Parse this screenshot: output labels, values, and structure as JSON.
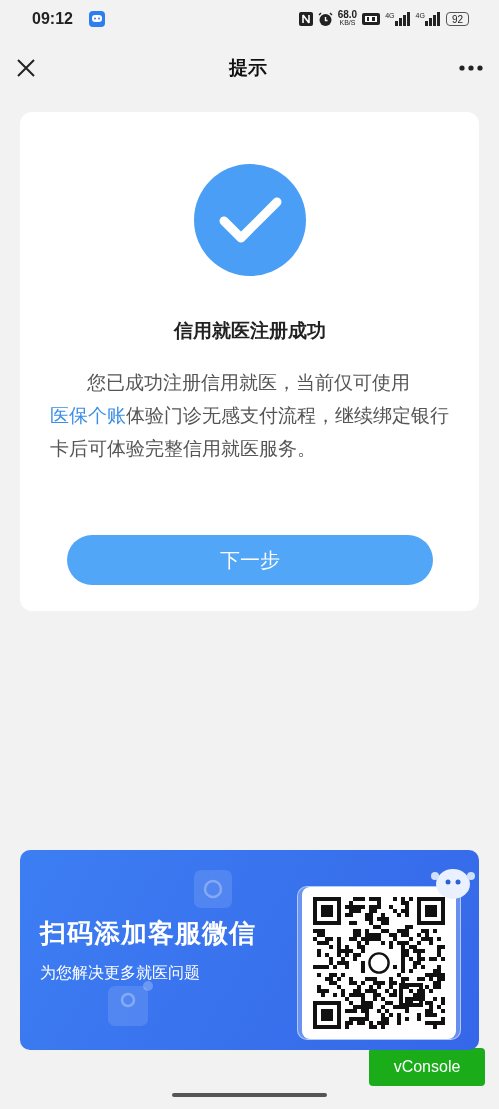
{
  "status_bar": {
    "time": "09:12",
    "net_speed": "68.0",
    "net_unit": "KB/S",
    "signals": [
      "4G",
      "4G"
    ],
    "battery": "92"
  },
  "nav_bar": {
    "title": "提示"
  },
  "result_card": {
    "title": "信用就医注册成功",
    "message": {
      "before": "您已成功注册信用就医，当前仅可使用",
      "link": "医保个账",
      "after": "体验门诊无感支付流程，继续绑定银行卡后可体验完整信用就医服务。"
    },
    "button": "下一步"
  },
  "banner": {
    "title": "扫码添加客服微信",
    "subtitle": "为您解决更多就医问题"
  },
  "vconsole": "vConsole"
}
